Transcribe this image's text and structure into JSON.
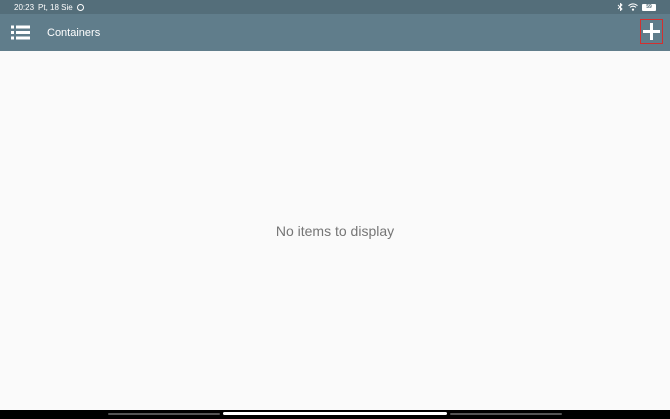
{
  "status_bar": {
    "time": "20:23",
    "date": "Pt, 18 Sie",
    "notification_icon": "circle-badge-icon",
    "battery_level": "59"
  },
  "app_bar": {
    "menu_icon": "list-menu-icon",
    "title": "Containers",
    "add_icon": "plus-icon"
  },
  "content": {
    "empty_message": "No items to display"
  },
  "colors": {
    "status_bar_bg": "#546e7a",
    "app_bar_bg": "#607d8b",
    "content_bg": "#fafafa",
    "empty_text": "#757575",
    "highlight_border": "#d32f2f"
  }
}
